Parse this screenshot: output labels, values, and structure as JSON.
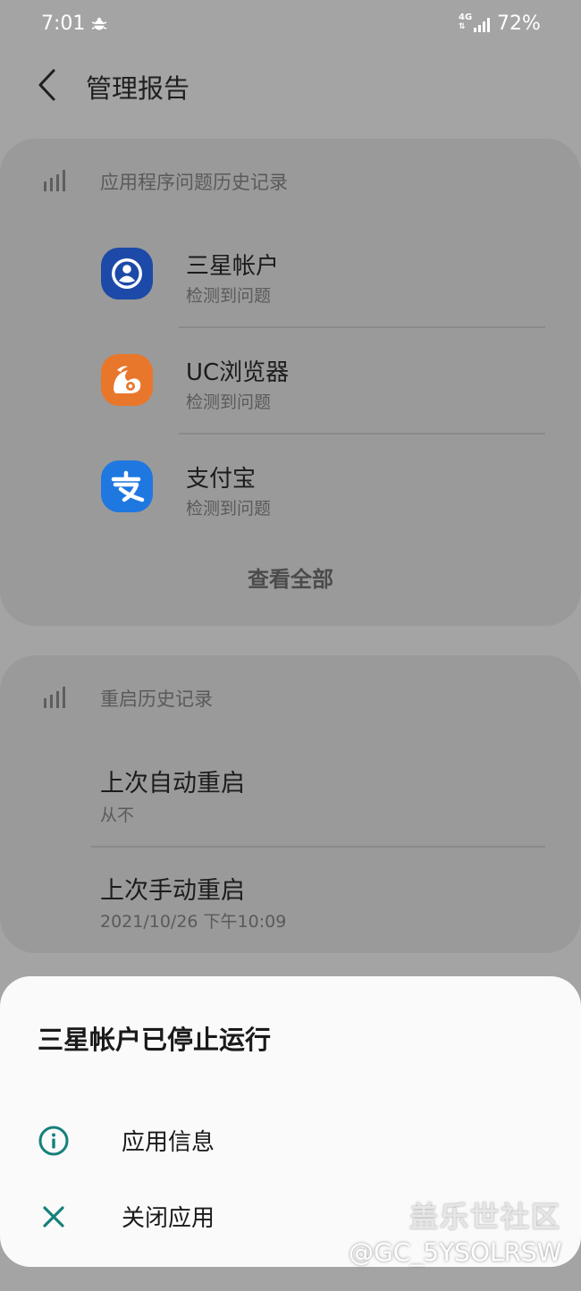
{
  "status_bar": {
    "time": "7:01",
    "network": "4G",
    "battery": "72%"
  },
  "header": {
    "title": "管理报告"
  },
  "app_issues": {
    "title": "应用程序问题历史记录",
    "items": [
      {
        "name": "三星帐户",
        "status": "检测到问题",
        "icon": "samsung-account-icon",
        "color": "#1d4aa8"
      },
      {
        "name": "UC浏览器",
        "status": "检测到问题",
        "icon": "uc-browser-icon",
        "color": "#e8772c"
      },
      {
        "name": "支付宝",
        "status": "检测到问题",
        "icon": "alipay-icon",
        "color": "#1f78e0"
      }
    ],
    "view_all": "查看全部"
  },
  "reboot_history": {
    "title": "重启历史记录",
    "items": [
      {
        "label": "上次自动重启",
        "value": "从不"
      },
      {
        "label": "上次手动重启",
        "value": "2021/10/26 下午10:09"
      }
    ]
  },
  "sheet": {
    "title": "三星帐户已停止运行",
    "actions": [
      {
        "label": "应用信息",
        "icon": "info-icon"
      },
      {
        "label": "关闭应用",
        "icon": "close-icon"
      }
    ],
    "accent": "#15807a"
  },
  "watermark": {
    "brand": "盖乐世社区",
    "user": "@GC_5YSOLRSW"
  }
}
